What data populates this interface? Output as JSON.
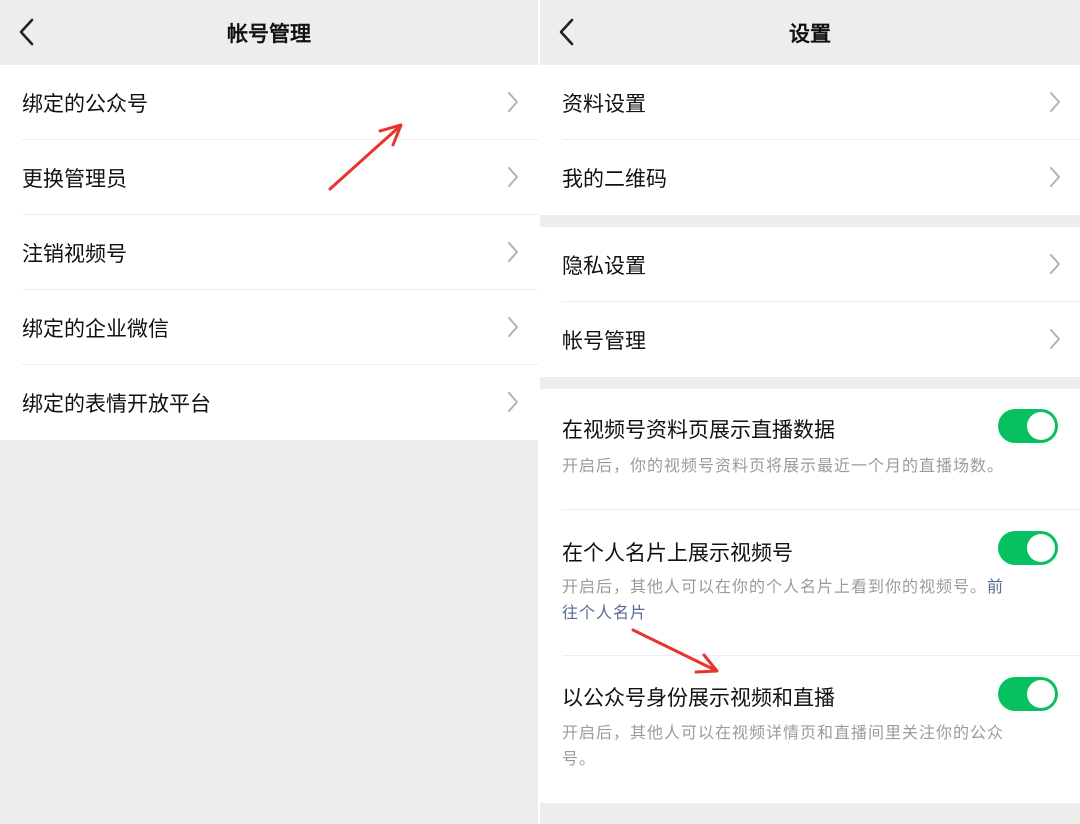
{
  "left": {
    "title": "帐号管理",
    "items": [
      {
        "label": "绑定的公众号"
      },
      {
        "label": "更换管理员"
      },
      {
        "label": "注销视频号"
      },
      {
        "label": "绑定的企业微信"
      },
      {
        "label": "绑定的表情开放平台"
      }
    ]
  },
  "right": {
    "title": "设置",
    "group1": [
      {
        "label": "资料设置"
      },
      {
        "label": "我的二维码"
      }
    ],
    "group2": [
      {
        "label": "隐私设置"
      },
      {
        "label": "帐号管理"
      }
    ],
    "toggles": [
      {
        "label": "在视频号资料页展示直播数据",
        "desc": "开启后，你的视频号资料页将展示最近一个月的直播场数。",
        "on": true
      },
      {
        "label": "在个人名片上展示视频号",
        "desc_line1": "开启后，其他人可以在你的个人名片上看到你的视频号。",
        "link_part1": "前",
        "link_part2": "往个人名片",
        "on": true
      },
      {
        "label": "以公众号身份展示视频和直播",
        "desc_line1": "开启后，其他人可以在视频详情页和直播间里关注你的公众",
        "desc_line2": "号。",
        "on": true
      }
    ]
  },
  "colors": {
    "switch_on": "#07c160",
    "link": "#576b95",
    "annotation_arrow": "#e8342c"
  },
  "icons": {
    "back": "chevron-left-icon",
    "row": "chevron-right-icon"
  }
}
